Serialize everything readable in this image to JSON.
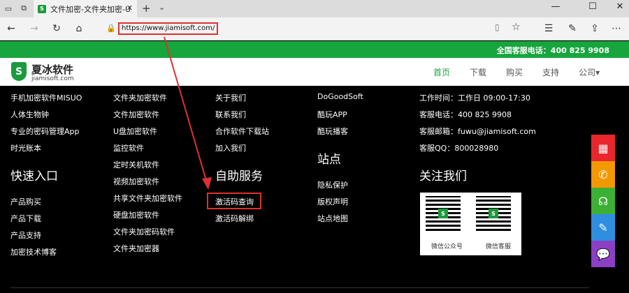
{
  "browser": {
    "tab_title": "文件加密-文件夹加密-U",
    "url": "https://www.jiamisoft.com/"
  },
  "site": {
    "hotline": "全国客服电话：400 825 9908",
    "logo_name": "夏冰软件",
    "logo_domain": "jiamisoft.com",
    "logo_letter": "S",
    "nav": [
      "首页",
      "下载",
      "购买",
      "支持",
      "公司▾"
    ]
  },
  "footer": {
    "col1_links": [
      "手机加密软件MISUO",
      "人体生物钟",
      "专业的密码管理App",
      "时光账本"
    ],
    "col1_heading": "快速入口",
    "col1_quick": [
      "产品购买",
      "产品下载",
      "产品支持",
      "加密技术博客"
    ],
    "col2_links": [
      "文件夹加密软件",
      "文件加密软件",
      "U盘加密软件",
      "监控软件",
      "定时关机软件",
      "视频加密软件",
      "共享文件夹加密软件",
      "硬盘加密软件",
      "文件夹加密码软件",
      "文件夹加密器"
    ],
    "col3_links": [
      "关于我们",
      "联系我们",
      "合作软件下载站",
      "加入我们"
    ],
    "col3_heading": "自助服务",
    "col3_service": [
      "激活码查询",
      "激活码解绑"
    ],
    "col4_links": [
      "DoGoodSoft",
      "酷玩APP",
      "酷玩播客"
    ],
    "col4_heading": "站点",
    "col4_site": [
      "隐私保护",
      "版权声明",
      "站点地图"
    ],
    "contact": [
      "工作时间：工作日 09:00-17:30",
      "客服电话：400 825 9908",
      "客服邮箱：fuwu@jiamisoft.com",
      "客服QQ：800028980"
    ],
    "follow_heading": "关注我们",
    "qr_captions": [
      "微信公众号",
      "微信客服"
    ]
  },
  "colors": {
    "brand_green": "#17a53d",
    "highlight_red": "#e03030",
    "sidebar": [
      "#e8262b",
      "#f39800",
      "#3cb034",
      "#2f8ee0",
      "#8b3fc4"
    ]
  },
  "sidebar_icons": [
    "calendar-icon",
    "phone-icon",
    "headset-icon",
    "edit-icon",
    "chat-icon"
  ]
}
